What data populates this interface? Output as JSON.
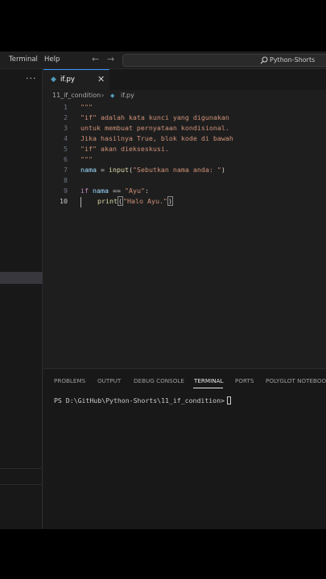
{
  "menu": {
    "terminal": "Terminal",
    "help": "Help",
    "search_text": "Python-Shorts",
    "back_arrow": "←",
    "forward_arrow": "→"
  },
  "sidebar": {
    "more": "···"
  },
  "editor": {
    "tab": {
      "label": "if.py",
      "icon": "python-file-icon",
      "close": "✕"
    },
    "breadcrumb": {
      "folder": "11_if_condition",
      "separator": "›",
      "file": "if.py"
    },
    "lines": [
      {
        "n": "1",
        "text": "\"\"\""
      },
      {
        "n": "2",
        "text": "\"if\" adalah kata kunci yang digunakan"
      },
      {
        "n": "3",
        "text": "untuk membuat pernyataan kondisional."
      },
      {
        "n": "4",
        "text": "Jika hasilnya True, blok kode di bawah"
      },
      {
        "n": "5",
        "text": "\"if\" akan diekseskusi."
      },
      {
        "n": "6",
        "text": "\"\"\""
      },
      {
        "n": "7",
        "code": {
          "var": "nama",
          "op": " = ",
          "fn": "input",
          "open": "(",
          "str": "\"Sebutkan nama anda: \"",
          "close": ")"
        }
      },
      {
        "n": "8",
        "text": ""
      },
      {
        "n": "9",
        "code": {
          "kw": "if",
          "var": " nama",
          "op": " == ",
          "str": "\"Ayu\"",
          "colon": ":"
        }
      },
      {
        "n": "10",
        "code": {
          "fn": "print",
          "open": "(",
          "str": "\"Halo Ayu.\"",
          "close": ")"
        }
      }
    ]
  },
  "panel": {
    "tabs": [
      "PROBLEMS",
      "OUTPUT",
      "DEBUG CONSOLE",
      "TERMINAL",
      "PORTS",
      "POLYGLOT NOTEBOOK"
    ],
    "active_tab": "TERMINAL",
    "prompt": "PS D:\\GitHub\\Python-Shorts\\11_if_condition>"
  },
  "colors": {
    "editor_bg": "#1e1e1e",
    "sidebar_bg": "#181818",
    "accent": "#007acc",
    "string": "#ce9178",
    "keyword": "#c586c0",
    "function": "#dcdcaa",
    "variable": "#9cdcfe"
  },
  "taskbar": {
    "items": [
      "wallpaper-thumbnail-icon",
      "task-view-icon",
      "lucid-app-icon",
      "outlook-icon",
      "edge-icon",
      "file-explorer-icon",
      "vscode-icon",
      "app-red-icon"
    ],
    "active": "vscode-icon"
  }
}
